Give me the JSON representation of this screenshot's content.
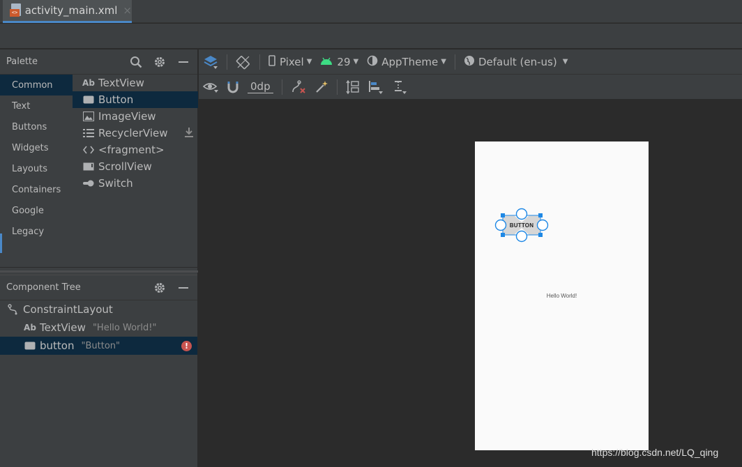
{
  "tab": {
    "title": "activity_main.xml",
    "close": "×"
  },
  "palette": {
    "title": "Palette",
    "categories": [
      "Common",
      "Text",
      "Buttons",
      "Widgets",
      "Layouts",
      "Containers",
      "Google",
      "Legacy"
    ],
    "active_category": "Common",
    "components": [
      {
        "label": "TextView",
        "icon": "ab-text-icon"
      },
      {
        "label": "Button",
        "icon": "button-icon"
      },
      {
        "label": "ImageView",
        "icon": "image-icon"
      },
      {
        "label": "RecyclerView",
        "icon": "list-icon"
      },
      {
        "label": "<fragment>",
        "icon": "code-brackets-icon"
      },
      {
        "label": "ScrollView",
        "icon": "scrollview-icon"
      },
      {
        "label": "Switch",
        "icon": "switch-icon"
      }
    ],
    "selected_component": "Button"
  },
  "component_tree": {
    "title": "Component Tree",
    "items": [
      {
        "label": "ConstraintLayout",
        "sub": ""
      },
      {
        "label": "TextView",
        "sub": "\"Hello World!\""
      },
      {
        "label": "button",
        "sub": "\"Button\""
      }
    ]
  },
  "toolbar": {
    "device": "Pixel",
    "api": "29",
    "theme": "AppTheme",
    "locale": "Default (en-us)",
    "margin": "0dp"
  },
  "design": {
    "hello_text": "Hello World!",
    "button_text": "BUTTON"
  },
  "colors": {
    "selection": "#0d293e",
    "accent": "#4a88c7",
    "android_green": "#3ddc84",
    "error": "#c75450",
    "handle_blue": "#1e88e5"
  },
  "watermark": "https://blog.csdn.net/LQ_qing"
}
